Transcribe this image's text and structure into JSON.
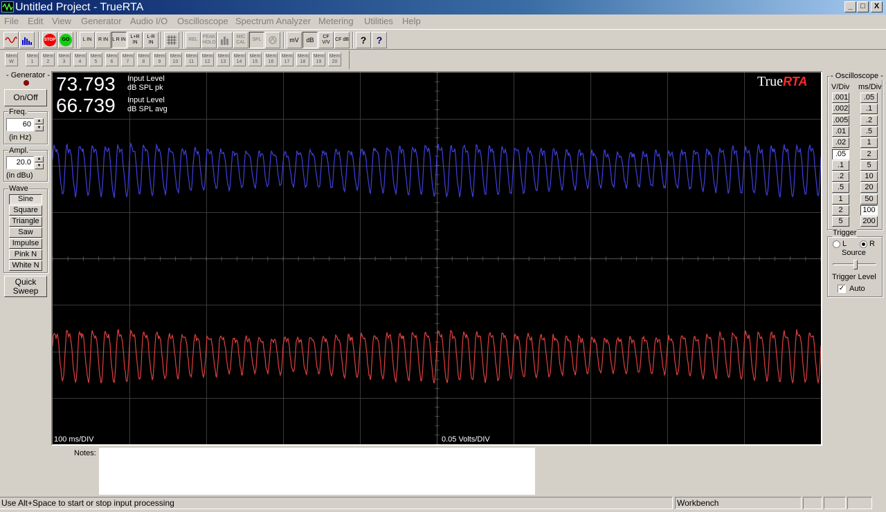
{
  "window": {
    "title": "Untitled Project - TrueRTA",
    "minimize": "_",
    "maximize": "□",
    "close": "X"
  },
  "menu": [
    "File",
    "Edit",
    "View",
    "Generator",
    "Audio I/O",
    "Oscilloscope",
    "Spectrum Analyzer",
    "Metering",
    "Utilities",
    "Help"
  ],
  "toolbar": {
    "stop": "STOP",
    "go": "GO",
    "inputs": [
      "L IN",
      "R IN",
      "L R IN",
      "L+R IN",
      "L-R IN"
    ],
    "rel": "REL",
    "peak_hold": "PEAK HOLD",
    "mic_cal": "MIC CAL",
    "spl": "SPL",
    "mv": "mV",
    "db": "dB",
    "cf_vv": "CF V/V",
    "cf_db": "CF dB",
    "help": "?",
    "whatsthis": "?"
  },
  "mem_toolbar": {
    "mem_w": "Mem W",
    "mems": [
      "Mem 1",
      "Mem 2",
      "Mem 3",
      "Mem 4",
      "Mem 5",
      "Mem 6",
      "Mem 7",
      "Mem 8",
      "Mem 9",
      "Mem 10",
      "Mem 11",
      "Mem 12",
      "Mem 13",
      "Mem 14",
      "Mem 15",
      "Mem 16",
      "Mem 17",
      "Mem 18",
      "Mem 19",
      "Mem 20"
    ]
  },
  "generator": {
    "label": "Generator",
    "on_off": "On/Off",
    "freq_label": "Freq.",
    "freq_value": "60",
    "freq_unit": "(in Hz)",
    "ampl_label": "Ampl.",
    "ampl_value": "20.0",
    "ampl_unit": "(in dBu)",
    "wave_label": "Wave",
    "waves": [
      "Sine",
      "Square",
      "Triangle",
      "Saw",
      "Impulse",
      "Pink N",
      "White N"
    ],
    "selected_wave": "Sine",
    "quick_sweep": "Quick Sweep"
  },
  "scope": {
    "peak_value": "73.793",
    "peak_label1": "Input Level",
    "peak_label2": "dB SPL pk",
    "avg_value": "66.739",
    "avg_label1": "Input Level",
    "avg_label2": "dB SPL avg",
    "brand_true": "True",
    "brand_rta": "RTA",
    "time_div": "100  ms/DIV",
    "volts_div": "0.05   Volts/DIV",
    "trace_colors": {
      "left": "#4040e0",
      "right": "#e04040"
    }
  },
  "oscilloscope": {
    "label": "Oscilloscope",
    "vdiv_header": "V/Div",
    "msdiv_header": "ms/Div",
    "vdiv": [
      ".001",
      ".002",
      ".005",
      ".01",
      ".02",
      ".05",
      ".1",
      ".2",
      ".5",
      "1",
      "2",
      "5"
    ],
    "msdiv": [
      ".05",
      ".1",
      ".2",
      ".5",
      "1",
      "2",
      "5",
      "10",
      "20",
      "50",
      "100",
      "200"
    ],
    "vdiv_selected": ".05",
    "msdiv_selected": "100",
    "trigger_label": "Trigger",
    "source_l": "L",
    "source_r": "R",
    "source_selected": "R",
    "source_label": "Source",
    "trigger_level_label": "Trigger Level",
    "auto_label": "Auto",
    "auto_checked": true
  },
  "notes": {
    "label": "Notes:",
    "value": ""
  },
  "status": {
    "hint": "Use Alt+Space to start or stop input processing",
    "mode": "Workbench"
  }
}
